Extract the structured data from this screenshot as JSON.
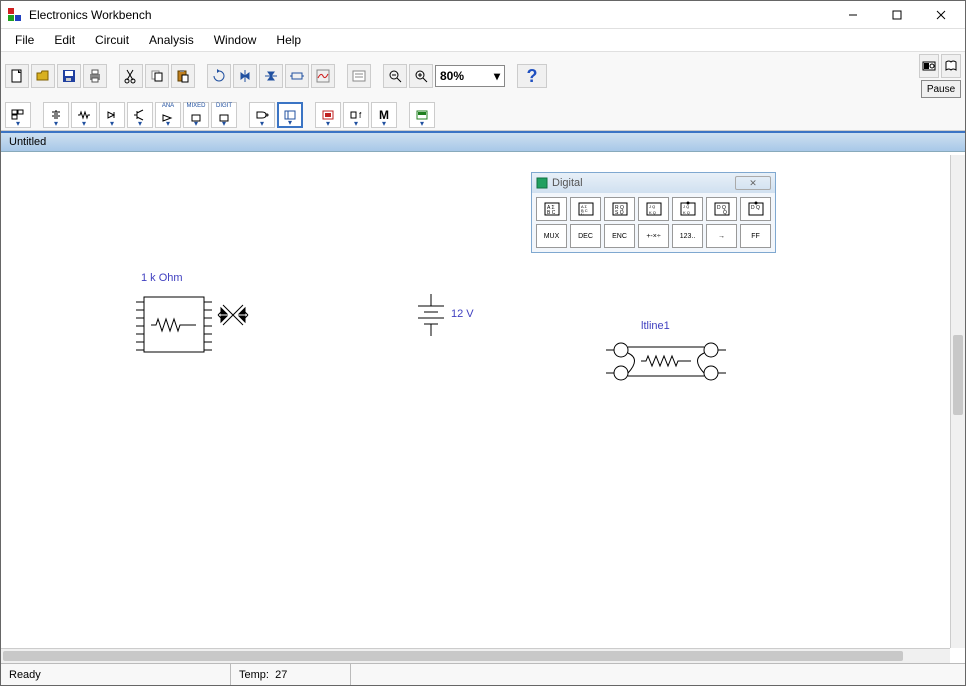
{
  "window": {
    "title": "Electronics Workbench"
  },
  "menu": {
    "file": "File",
    "edit": "Edit",
    "circuit": "Circuit",
    "analysis": "Analysis",
    "window": "Window",
    "help": "Help"
  },
  "toolbar": {
    "zoom": "80%",
    "pause": "Pause"
  },
  "document": {
    "title": "Untitled"
  },
  "palette": {
    "title": "Digital",
    "row2": {
      "mux": "MUX",
      "dec": "DEC",
      "enc": "ENC",
      "arith": "+-×÷",
      "cnt": "123..",
      "shift": "→",
      "ff": "FF"
    }
  },
  "components": {
    "resistor_pack": {
      "label": "1 k Ohm"
    },
    "battery": {
      "label": "12 V"
    },
    "tline": {
      "label": "ltline1"
    }
  },
  "status": {
    "ready": "Ready",
    "temp_label": "Temp:",
    "temp_value": "27"
  }
}
